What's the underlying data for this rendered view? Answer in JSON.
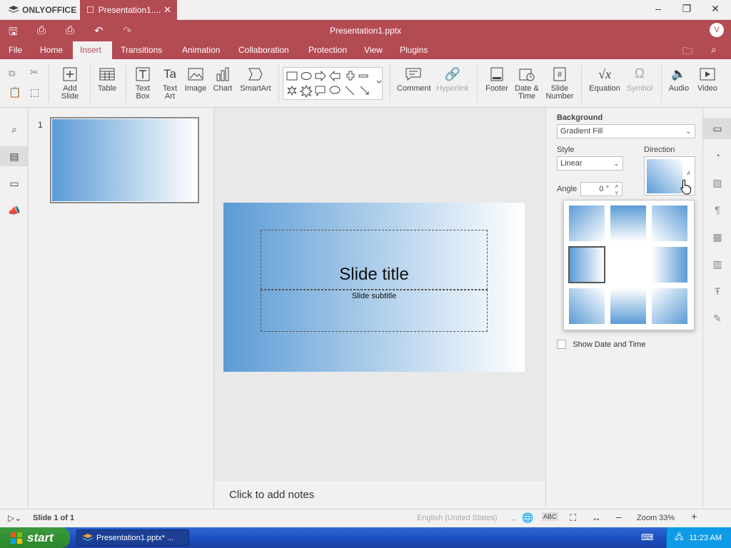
{
  "app": {
    "name": "ONLYOFFICE"
  },
  "tab": {
    "title": "Presentation1...."
  },
  "window": {
    "minimize": "–",
    "maximize": "❐",
    "close": "✕"
  },
  "document": {
    "title": "Presentation1.pptx",
    "user_initial": "V"
  },
  "menu": [
    "File",
    "Home",
    "Insert",
    "Transitions",
    "Animation",
    "Collaboration",
    "Protection",
    "View",
    "Plugins"
  ],
  "active_menu": "Insert",
  "ribbon": {
    "add_slide": "Add\nSlide",
    "table": "Table",
    "text_box": "Text\nBox",
    "text_art": "Text\nArt",
    "image": "Image",
    "chart": "Chart",
    "smartart": "SmartArt",
    "comment": "Comment",
    "hyperlink": "Hyperlink",
    "footer": "Footer",
    "date_time": "Date &\nTime",
    "slide_number": "Slide\nNumber",
    "equation": "Equation",
    "symbol": "Symbol",
    "audio": "Audio",
    "video": "Video"
  },
  "thumbnails": [
    {
      "number": "1"
    }
  ],
  "slide": {
    "title": "Slide title",
    "subtitle": "Slide subtitle"
  },
  "notes": {
    "placeholder": "Click to add notes"
  },
  "right_panel": {
    "background_label": "Background",
    "fill_type": "Gradient Fill",
    "style_label": "Style",
    "style_value": "Linear",
    "direction_label": "Direction",
    "angle_label": "Angle",
    "angle_value": "0 °",
    "show_date_time": "Show Date and Time"
  },
  "status": {
    "slide_info": "Slide 1 of 1",
    "language": "English (United States)",
    "zoom": "Zoom 33%"
  },
  "taskbar": {
    "start": "start",
    "item": "Presentation1.pptx* ...",
    "time": "11:23 AM"
  },
  "colors": {
    "accent": "#b34b53",
    "gradient_start": "#5b9bd5",
    "gradient_end": "#ffffff"
  }
}
